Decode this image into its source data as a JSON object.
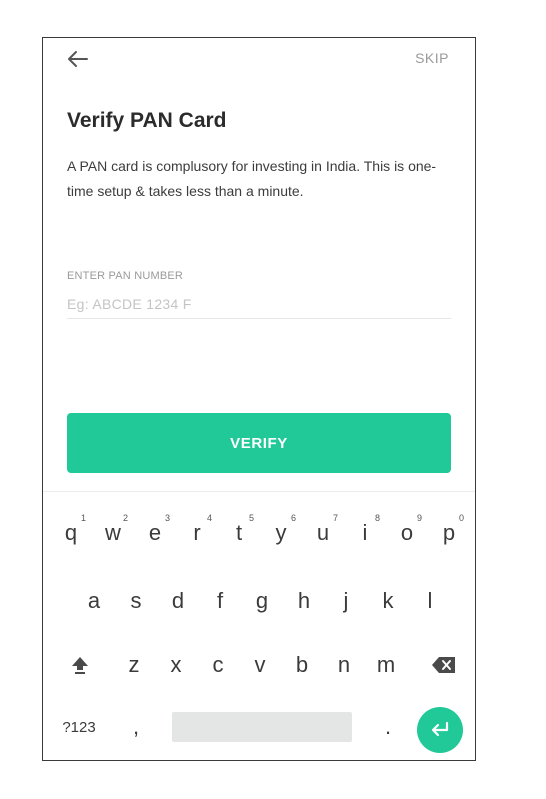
{
  "header": {
    "back_icon": "arrow-left-icon",
    "skip_label": "SKIP"
  },
  "main": {
    "title": "Verify PAN Card",
    "description": "A PAN card is complusory for investing in India. This is one-time setup & takes less than a minute.",
    "pan_field": {
      "label": "ENTER PAN NUMBER",
      "placeholder": "Eg: ABCDE 1234 F",
      "value": ""
    },
    "verify_label": "VERIFY"
  },
  "keyboard": {
    "row1": [
      {
        "char": "q",
        "num": "1"
      },
      {
        "char": "w",
        "num": "2"
      },
      {
        "char": "e",
        "num": "3"
      },
      {
        "char": "r",
        "num": "4"
      },
      {
        "char": "t",
        "num": "5"
      },
      {
        "char": "y",
        "num": "6"
      },
      {
        "char": "u",
        "num": "7"
      },
      {
        "char": "i",
        "num": "8"
      },
      {
        "char": "o",
        "num": "9"
      },
      {
        "char": "p",
        "num": "0"
      }
    ],
    "row2": [
      "a",
      "s",
      "d",
      "f",
      "g",
      "h",
      "j",
      "k",
      "l"
    ],
    "row3": [
      "z",
      "x",
      "c",
      "v",
      "b",
      "n",
      "m"
    ],
    "symbols_label": "?123",
    "comma_label": ",",
    "period_label": ".",
    "shift_icon": "shift-icon",
    "backspace_icon": "backspace-icon",
    "enter_icon": "enter-icon"
  },
  "colors": {
    "accent": "#20c997",
    "text_primary": "#2b2b2b",
    "text_muted": "#9a9a9a"
  }
}
